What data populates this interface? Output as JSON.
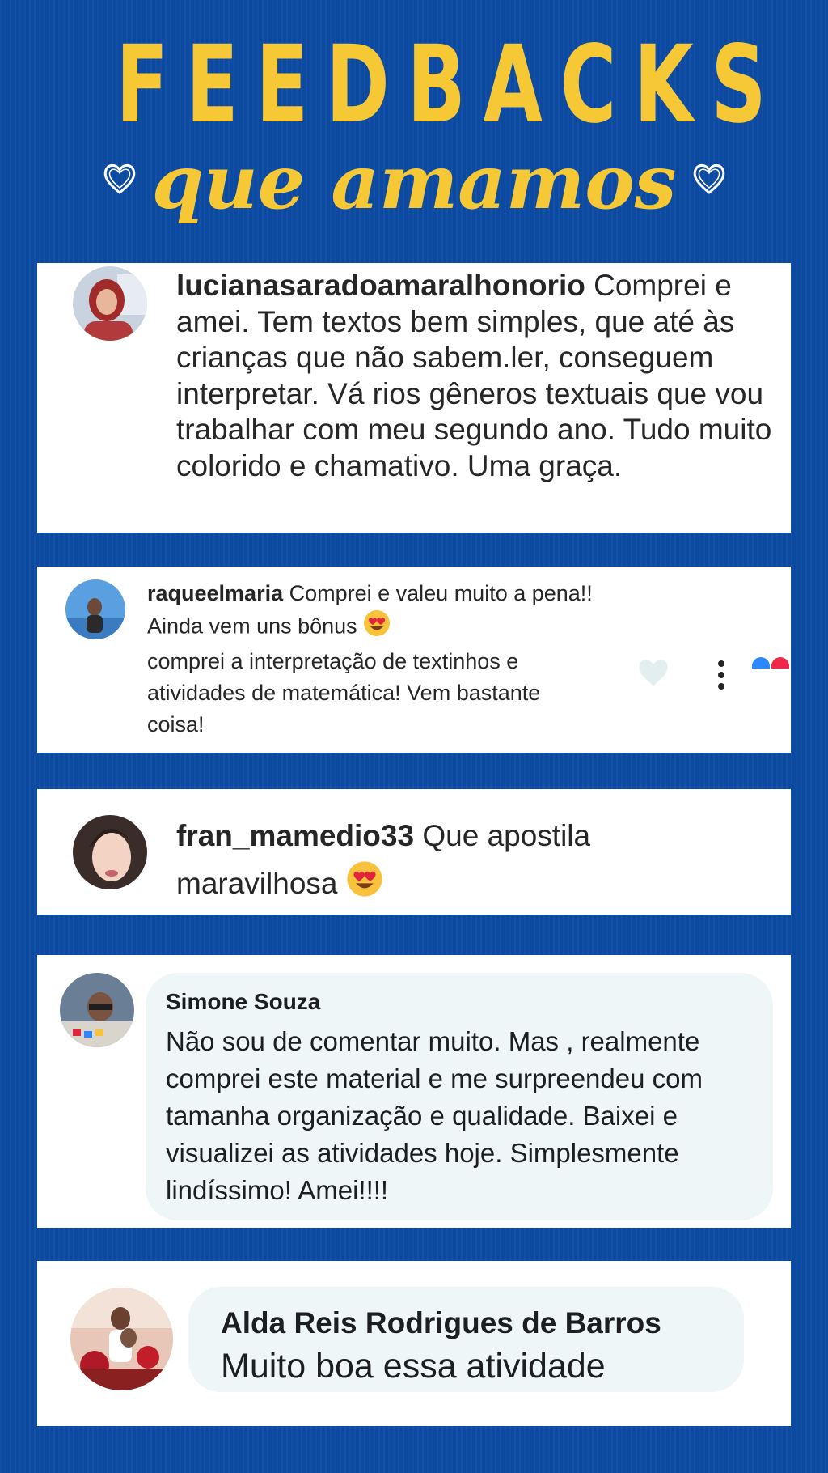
{
  "header": {
    "title": "FEEDBACKS",
    "subtitle": "que amamos"
  },
  "colors": {
    "background": "#0b4aa0",
    "accent_yellow": "#f6c836",
    "card": "#ffffff",
    "bubble": "#eef6f8"
  },
  "comments": [
    {
      "username": "lucianasaradoamaralhonorio",
      "text": " Comprei e amei. Tem textos bem simples, que até às crianças que não sabem.ler, conseguem interpretar. Vá rios gêneros textuais que vou trabalhar com meu segundo ano. Tudo muito colorido e chamativo. Uma graça."
    },
    {
      "username": "raqueelmaria",
      "text_before_emoji": " Comprei e valeu muito a pena!! Ainda vem uns bônus ",
      "emoji": "heart-eyes-emoji",
      "text_after_emoji": " comprei a interpretação de textinhos e atividades de matemática! Vem bastante coisa!",
      "actions": [
        "heart-icon",
        "more-options-icon"
      ]
    },
    {
      "username": "fran_mamedio33",
      "text": " Que apostila maravilhosa ",
      "emoji": "heart-eyes-emoji"
    },
    {
      "username": "Simone Souza",
      "text": "Não sou de comentar muito. Mas , realmente comprei este material e me surpreendeu com tamanha organização e qualidade. Baixei e visualizei as atividades hoje. Simplesmente lindíssimo! Amei!!!!"
    },
    {
      "username": "Alda Reis Rodrigues de Barros",
      "text": "Muito boa essa atividade"
    }
  ]
}
